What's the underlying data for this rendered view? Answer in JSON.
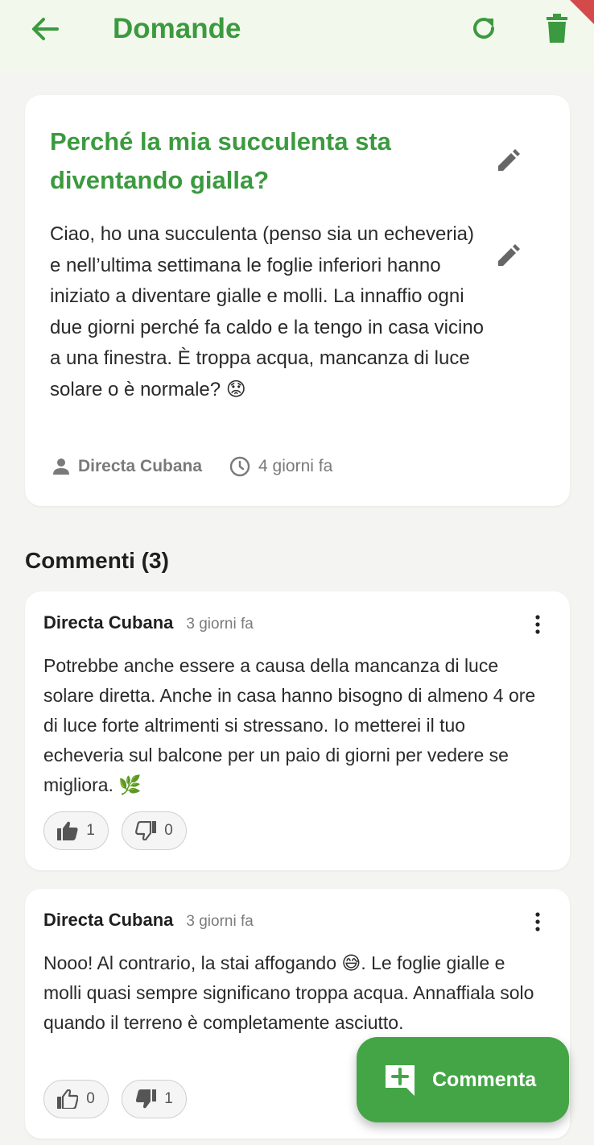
{
  "appbar": {
    "title": "Domande",
    "back_icon": "arrow-left-icon",
    "refresh_icon": "refresh-icon",
    "delete_icon": "trash-icon"
  },
  "question": {
    "title": "Perché la mia succulenta sta diventando gialla?",
    "body": "Ciao, ho una succulenta (penso sia un echeveria) e nell’ultima settimana le foglie inferiori hanno iniziato a diventare gialle e molli. La innaffio ogni due giorni perché fa caldo e la tengo in casa vicino a una finestra. È troppa acqua, mancanza di luce solare o è normale? 😟",
    "author": "Directa Cubana",
    "time": "4 giorni fa"
  },
  "comments_section": {
    "title": "Commenti (3)"
  },
  "comments": [
    {
      "author": "Directa Cubana",
      "time": "3 giorni fa",
      "body": "Potrebbe anche essere a causa della mancanza di luce solare diretta. Anche in casa hanno bisogno di almeno 4 ore di luce forte altrimenti si stressano. Io metterei il tuo echeveria sul balcone per un paio di giorni per vedere se migliora. 🌿",
      "likes": "1",
      "dislikes": "0",
      "liked": true,
      "disliked": false
    },
    {
      "author": "Directa Cubana",
      "time": "3 giorni fa",
      "body": "Nooo! Al contrario, la stai affogando 😅. Le foglie gialle e molli quasi sempre significano troppa acqua. Annaffiala solo quando il terreno è completamente asciutto.",
      "likes": "0",
      "dislikes": "1",
      "liked": false,
      "disliked": true
    }
  ],
  "fab": {
    "label": "Commenta",
    "icon": "add-comment-icon"
  },
  "colors": {
    "primary": "#3b9a3f",
    "fab": "#44a546",
    "appbar_bg": "#f3f8ec",
    "page_bg": "#f4f5f2"
  }
}
